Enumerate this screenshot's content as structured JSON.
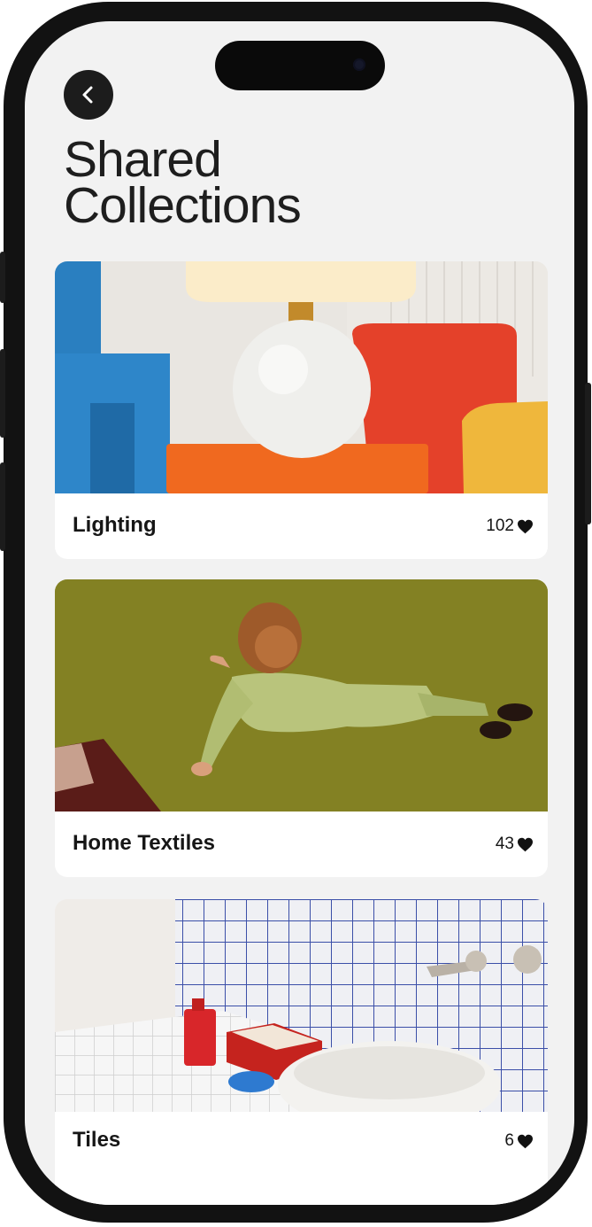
{
  "page": {
    "title_line1": "Shared",
    "title_line2": "Collections"
  },
  "icons": {
    "back": "chevron-left-icon",
    "like": "heart-icon"
  },
  "collections": [
    {
      "name": "Lighting",
      "likes": "102"
    },
    {
      "name": "Home Textiles",
      "likes": "43"
    },
    {
      "name": "Tiles",
      "likes": "6"
    }
  ]
}
